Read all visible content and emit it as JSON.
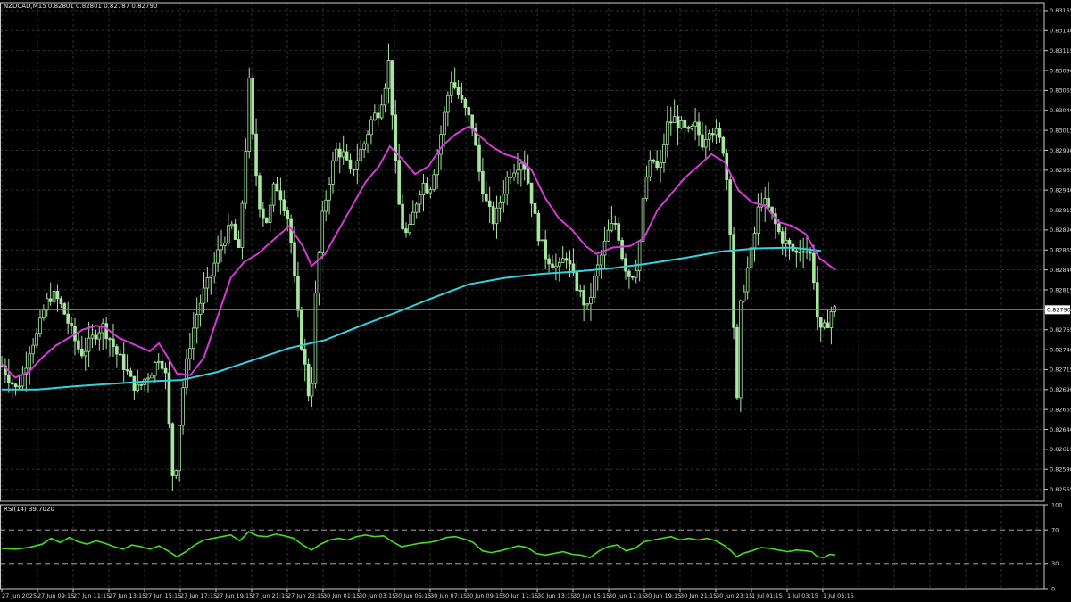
{
  "header": {
    "symbol_info": "NZDCAD,M15  0.82801 0.82801 0.82787 0.82790",
    "rsi_label": "RSI(14) 39.7020"
  },
  "colors": {
    "background": "#000000",
    "grid": "#2e2e2e",
    "axis": "#c8c8c8",
    "candle": "#a8e6a1",
    "ma_fast": "#d63ad6",
    "ma_slow": "#35d1de",
    "rsi_line": "#44dd22",
    "price_tag_bg": "#ffffff"
  },
  "chart_data": [
    {
      "type": "candlestick",
      "symbol": "NZDCAD",
      "timeframe": "M15",
      "ylim": [
        0.8255,
        0.83175
      ],
      "price_ticks": [
        "0.83165",
        "0.83140",
        "0.83115",
        "0.83090",
        "0.83065",
        "0.83040",
        "0.83015",
        "0.82990",
        "0.82965",
        "0.82940",
        "0.82915",
        "0.82890",
        "0.82865",
        "0.82840",
        "0.82815",
        "0.82790",
        "0.82765",
        "0.82740",
        "0.82715",
        "0.82690",
        "0.82665",
        "0.82640",
        "0.82615",
        "0.82590",
        "0.82565"
      ],
      "current_price": "0.82790",
      "time_ticks": [
        "27 Jun 2025",
        "27 Jun 09:15",
        "27 Jun 11:15",
        "27 Jun 13:15",
        "27 Jun 15:15",
        "27 Jun 17:15",
        "27 Jun 19:15",
        "27 Jun 21:15",
        "27 Jun 23:15",
        "30 Jun 01:15",
        "30 Jun 03:15",
        "30 Jun 05:15",
        "30 Jun 07:15",
        "30 Jun 09:15",
        "30 Jun 11:15",
        "30 Jun 13:15",
        "30 Jun 15:15",
        "30 Jun 17:15",
        "30 Jun 19:15",
        "30 Jun 21:15",
        "30 Jun 23:15",
        "1 Jul 01:15",
        "1 Jul 03:15",
        "1 Jul 05:15"
      ],
      "close_path": [
        [
          0,
          0.8272
        ],
        [
          8,
          0.82705
        ],
        [
          16,
          0.8269
        ],
        [
          24,
          0.8271
        ],
        [
          32,
          0.82745
        ],
        [
          40,
          0.8276
        ],
        [
          48,
          0.82795
        ],
        [
          56,
          0.8281
        ],
        [
          64,
          0.828
        ],
        [
          72,
          0.8278
        ],
        [
          80,
          0.82755
        ],
        [
          88,
          0.82735
        ],
        [
          96,
          0.82745
        ],
        [
          104,
          0.8276
        ],
        [
          112,
          0.8277
        ],
        [
          120,
          0.82755
        ],
        [
          128,
          0.82735
        ],
        [
          136,
          0.8272
        ],
        [
          144,
          0.827
        ],
        [
          152,
          0.8269
        ],
        [
          160,
          0.82705
        ],
        [
          168,
          0.82715
        ],
        [
          176,
          0.82735
        ],
        [
          184,
          0.827
        ],
        [
          188,
          0.826
        ],
        [
          192,
          0.8257
        ],
        [
          196,
          0.8262
        ],
        [
          200,
          0.8268
        ],
        [
          208,
          0.8274
        ],
        [
          216,
          0.8278
        ],
        [
          224,
          0.8281
        ],
        [
          232,
          0.8283
        ],
        [
          240,
          0.8286
        ],
        [
          248,
          0.8288
        ],
        [
          256,
          0.82895
        ],
        [
          264,
          0.8286
        ],
        [
          272,
          0.83
        ],
        [
          276,
          0.83085
        ],
        [
          280,
          0.8299
        ],
        [
          288,
          0.82915
        ],
        [
          296,
          0.829
        ],
        [
          304,
          0.8295
        ],
        [
          312,
          0.8293
        ],
        [
          320,
          0.829
        ],
        [
          328,
          0.828
        ],
        [
          332,
          0.8276
        ],
        [
          340,
          0.827
        ],
        [
          344,
          0.8266
        ],
        [
          348,
          0.8279
        ],
        [
          356,
          0.829
        ],
        [
          364,
          0.8295
        ],
        [
          372,
          0.8299
        ],
        [
          380,
          0.82985
        ],
        [
          388,
          0.8296
        ],
        [
          396,
          0.8298
        ],
        [
          404,
          0.83
        ],
        [
          412,
          0.8303
        ],
        [
          420,
          0.8304
        ],
        [
          428,
          0.8308
        ],
        [
          432,
          0.8311
        ],
        [
          436,
          0.83
        ],
        [
          444,
          0.829
        ],
        [
          452,
          0.8288
        ],
        [
          460,
          0.8292
        ],
        [
          468,
          0.8295
        ],
        [
          476,
          0.8294
        ],
        [
          484,
          0.8298
        ],
        [
          492,
          0.8303
        ],
        [
          500,
          0.8308
        ],
        [
          508,
          0.8306
        ],
        [
          516,
          0.8304
        ],
        [
          524,
          0.8302
        ],
        [
          532,
          0.8296
        ],
        [
          540,
          0.8292
        ],
        [
          548,
          0.829
        ],
        [
          556,
          0.8293
        ],
        [
          564,
          0.8296
        ],
        [
          572,
          0.8297
        ],
        [
          580,
          0.8298
        ],
        [
          588,
          0.8294
        ],
        [
          596,
          0.8289
        ],
        [
          604,
          0.8286
        ],
        [
          612,
          0.8285
        ],
        [
          620,
          0.8284
        ],
        [
          628,
          0.8286
        ],
        [
          636,
          0.8283
        ],
        [
          644,
          0.8281
        ],
        [
          652,
          0.8279
        ],
        [
          660,
          0.8283
        ],
        [
          668,
          0.8286
        ],
        [
          676,
          0.8289
        ],
        [
          684,
          0.829
        ],
        [
          692,
          0.8285
        ],
        [
          700,
          0.8283
        ],
        [
          708,
          0.8285
        ],
        [
          716,
          0.8295
        ],
        [
          724,
          0.8298
        ],
        [
          732,
          0.8296
        ],
        [
          740,
          0.8302
        ],
        [
          748,
          0.8303
        ],
        [
          756,
          0.8302
        ],
        [
          764,
          0.8301
        ],
        [
          772,
          0.8302
        ],
        [
          780,
          0.83
        ],
        [
          788,
          0.8302
        ],
        [
          796,
          0.8301
        ],
        [
          804,
          0.8299
        ],
        [
          810,
          0.8292
        ],
        [
          814,
          0.828
        ],
        [
          818,
          0.8265
        ],
        [
          822,
          0.8279
        ],
        [
          828,
          0.8283
        ],
        [
          836,
          0.8287
        ],
        [
          844,
          0.8293
        ],
        [
          852,
          0.8292
        ],
        [
          860,
          0.829
        ],
        [
          868,
          0.8288
        ],
        [
          876,
          0.8287
        ],
        [
          884,
          0.8286
        ],
        [
          892,
          0.8287
        ],
        [
          900,
          0.8286
        ],
        [
          904,
          0.8283
        ],
        [
          908,
          0.8278
        ],
        [
          912,
          0.8276
        ],
        [
          918,
          0.8277
        ],
        [
          924,
          0.8279
        ],
        [
          928,
          0.8279
        ]
      ],
      "series": [
        {
          "values": [
            [
              0,
              0.82722
            ],
            [
              15,
              0.82705
            ],
            [
              30,
              0.82712
            ],
            [
              45,
              0.8273
            ],
            [
              60,
              0.82745
            ],
            [
              75,
              0.82755
            ],
            [
              90,
              0.82765
            ],
            [
              105,
              0.8277
            ],
            [
              115,
              0.82768
            ],
            [
              130,
              0.82755
            ],
            [
              150,
              0.82745
            ],
            [
              165,
              0.82738
            ],
            [
              175,
              0.82748
            ],
            [
              185,
              0.8273
            ],
            [
              195,
              0.8271
            ],
            [
              210,
              0.82708
            ],
            [
              225,
              0.8273
            ],
            [
              240,
              0.8278
            ],
            [
              255,
              0.8283
            ],
            [
              270,
              0.8285
            ],
            [
              285,
              0.8286
            ],
            [
              300,
              0.82875
            ],
            [
              320,
              0.82895
            ],
            [
              335,
              0.8287
            ],
            [
              345,
              0.82845
            ],
            [
              360,
              0.8286
            ],
            [
              375,
              0.8289
            ],
            [
              390,
              0.8292
            ],
            [
              405,
              0.8295
            ],
            [
              420,
              0.8297
            ],
            [
              432,
              0.82995
            ],
            [
              445,
              0.8298
            ],
            [
              460,
              0.8296
            ],
            [
              475,
              0.8297
            ],
            [
              490,
              0.82995
            ],
            [
              505,
              0.8301
            ],
            [
              520,
              0.8302
            ],
            [
              530,
              0.8301
            ],
            [
              545,
              0.82995
            ],
            [
              560,
              0.82985
            ],
            [
              575,
              0.8298
            ],
            [
              590,
              0.82965
            ],
            [
              605,
              0.8293
            ],
            [
              620,
              0.82905
            ],
            [
              635,
              0.8289
            ],
            [
              650,
              0.8287
            ],
            [
              662,
              0.8286
            ],
            [
              680,
              0.82868
            ],
            [
              700,
              0.8287
            ],
            [
              715,
              0.8288
            ],
            [
              730,
              0.82915
            ],
            [
              745,
              0.82935
            ],
            [
              760,
              0.82955
            ],
            [
              775,
              0.8297
            ],
            [
              790,
              0.82985
            ],
            [
              805,
              0.82975
            ],
            [
              820,
              0.8294
            ],
            [
              835,
              0.82925
            ],
            [
              850,
              0.8292
            ],
            [
              865,
              0.829
            ],
            [
              880,
              0.82895
            ],
            [
              895,
              0.82885
            ],
            [
              910,
              0.82855
            ],
            [
              928,
              0.8284
            ]
          ]
        },
        {
          "values": [
            [
              0,
              0.8269
            ],
            [
              40,
              0.8269
            ],
            [
              80,
              0.82694
            ],
            [
              120,
              0.82697
            ],
            [
              160,
              0.827
            ],
            [
              200,
              0.82702
            ],
            [
              240,
              0.82712
            ],
            [
              280,
              0.82727
            ],
            [
              320,
              0.82742
            ],
            [
              360,
              0.82752
            ],
            [
              400,
              0.8277
            ],
            [
              440,
              0.82787
            ],
            [
              480,
              0.82805
            ],
            [
              520,
              0.82822
            ],
            [
              560,
              0.8283
            ],
            [
              600,
              0.82835
            ],
            [
              640,
              0.82838
            ],
            [
              680,
              0.82842
            ],
            [
              720,
              0.82848
            ],
            [
              760,
              0.82855
            ],
            [
              800,
              0.82863
            ],
            [
              840,
              0.82867
            ],
            [
              880,
              0.82868
            ],
            [
              912,
              0.82864
            ]
          ]
        }
      ]
    },
    {
      "type": "line",
      "ylim": [
        0,
        100
      ],
      "y_ticks": [
        "100",
        "70",
        "30",
        "0"
      ],
      "levels": [
        70,
        30
      ],
      "values": [
        [
          0,
          48
        ],
        [
          15,
          47
        ],
        [
          30,
          49
        ],
        [
          45,
          53
        ],
        [
          55,
          60
        ],
        [
          65,
          55
        ],
        [
          75,
          61
        ],
        [
          85,
          56
        ],
        [
          95,
          53
        ],
        [
          105,
          57
        ],
        [
          115,
          54
        ],
        [
          125,
          50
        ],
        [
          135,
          47
        ],
        [
          145,
          52
        ],
        [
          155,
          50
        ],
        [
          165,
          47
        ],
        [
          175,
          51
        ],
        [
          185,
          45
        ],
        [
          195,
          38
        ],
        [
          205,
          44
        ],
        [
          215,
          52
        ],
        [
          225,
          58
        ],
        [
          235,
          60
        ],
        [
          245,
          62
        ],
        [
          255,
          64
        ],
        [
          265,
          57
        ],
        [
          275,
          68
        ],
        [
          285,
          63
        ],
        [
          295,
          62
        ],
        [
          305,
          65
        ],
        [
          315,
          63
        ],
        [
          325,
          60
        ],
        [
          335,
          52
        ],
        [
          345,
          46
        ],
        [
          355,
          53
        ],
        [
          365,
          58
        ],
        [
          375,
          60
        ],
        [
          385,
          58
        ],
        [
          395,
          62
        ],
        [
          405,
          64
        ],
        [
          415,
          62
        ],
        [
          425,
          63
        ],
        [
          435,
          56
        ],
        [
          445,
          50
        ],
        [
          455,
          52
        ],
        [
          465,
          54
        ],
        [
          475,
          55
        ],
        [
          485,
          57
        ],
        [
          495,
          61
        ],
        [
          505,
          62
        ],
        [
          515,
          59
        ],
        [
          525,
          55
        ],
        [
          535,
          45
        ],
        [
          545,
          43
        ],
        [
          555,
          45
        ],
        [
          565,
          48
        ],
        [
          575,
          51
        ],
        [
          585,
          49
        ],
        [
          595,
          42
        ],
        [
          605,
          40
        ],
        [
          615,
          42
        ],
        [
          625,
          44
        ],
        [
          635,
          41
        ],
        [
          645,
          40
        ],
        [
          655,
          37
        ],
        [
          665,
          45
        ],
        [
          675,
          50
        ],
        [
          685,
          52
        ],
        [
          695,
          45
        ],
        [
          705,
          48
        ],
        [
          715,
          56
        ],
        [
          725,
          58
        ],
        [
          735,
          60
        ],
        [
          745,
          62
        ],
        [
          755,
          58
        ],
        [
          765,
          60
        ],
        [
          775,
          58
        ],
        [
          785,
          60
        ],
        [
          795,
          57
        ],
        [
          805,
          51
        ],
        [
          812,
          45
        ],
        [
          818,
          38
        ],
        [
          825,
          42
        ],
        [
          835,
          45
        ],
        [
          845,
          49
        ],
        [
          855,
          48
        ],
        [
          865,
          46
        ],
        [
          875,
          44
        ],
        [
          885,
          46
        ],
        [
          895,
          45
        ],
        [
          902,
          44
        ],
        [
          908,
          38
        ],
        [
          915,
          37
        ],
        [
          922,
          41
        ],
        [
          928,
          40
        ]
      ]
    }
  ]
}
